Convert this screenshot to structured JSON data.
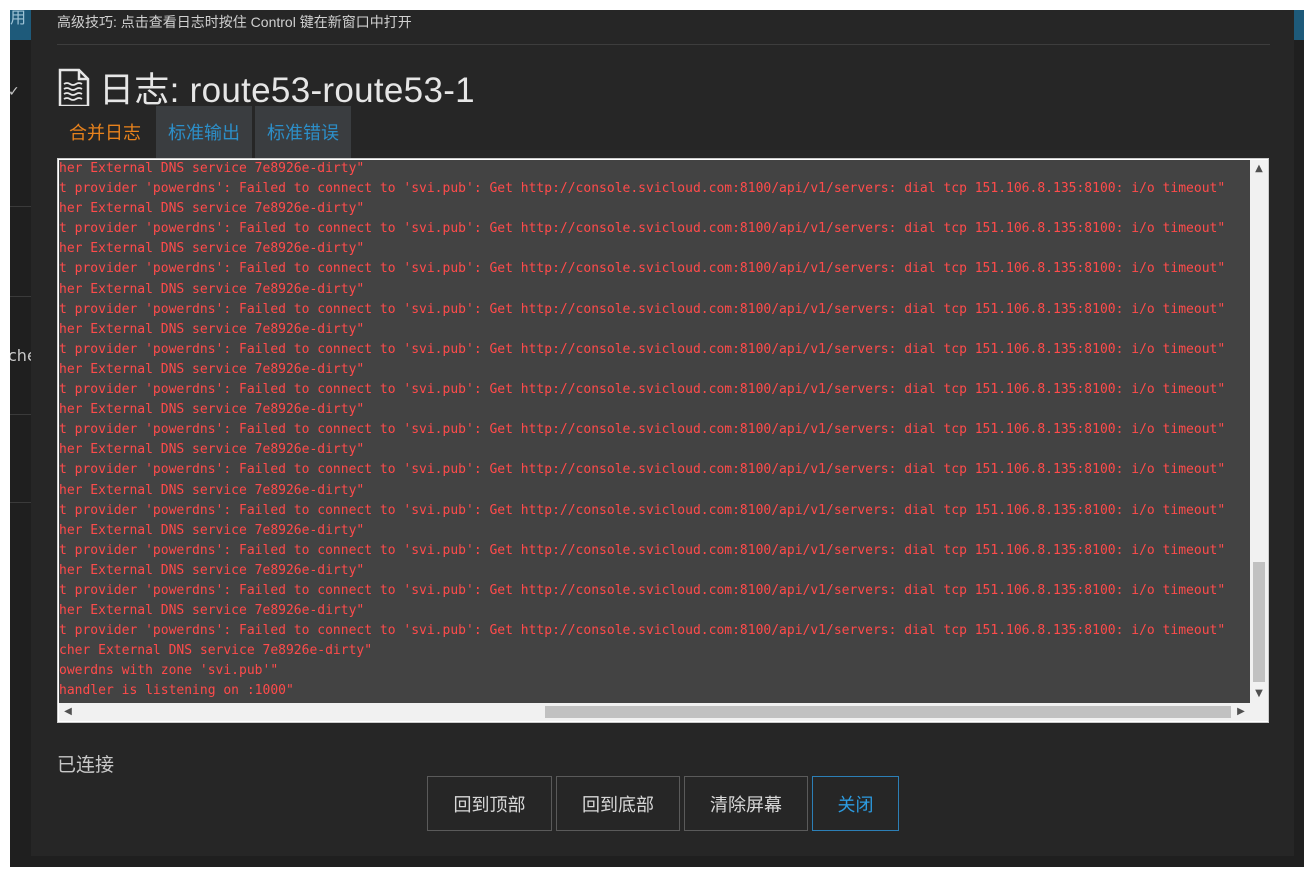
{
  "background": {
    "corner_text": "用",
    "side_text": "che"
  },
  "modal": {
    "tip": "高级技巧: 点击查看日志时按住 Control 键在新窗口中打开",
    "title": "日志: route53-route53-1",
    "tabs": [
      {
        "label": "合并日志",
        "active": true
      },
      {
        "label": "标准输出",
        "active": false
      },
      {
        "label": "标准错误",
        "active": false
      }
    ],
    "log_lines": [
      "her External DNS service 7e8926e-dirty\"",
      "t provider 'powerdns': Failed to connect to 'svi.pub': Get http://console.svicloud.com:8100/api/v1/servers: dial tcp 151.106.8.135:8100: i/o timeout\"",
      "her External DNS service 7e8926e-dirty\"",
      "t provider 'powerdns': Failed to connect to 'svi.pub': Get http://console.svicloud.com:8100/api/v1/servers: dial tcp 151.106.8.135:8100: i/o timeout\"",
      "her External DNS service 7e8926e-dirty\"",
      "t provider 'powerdns': Failed to connect to 'svi.pub': Get http://console.svicloud.com:8100/api/v1/servers: dial tcp 151.106.8.135:8100: i/o timeout\"",
      "her External DNS service 7e8926e-dirty\"",
      "t provider 'powerdns': Failed to connect to 'svi.pub': Get http://console.svicloud.com:8100/api/v1/servers: dial tcp 151.106.8.135:8100: i/o timeout\"",
      "her External DNS service 7e8926e-dirty\"",
      "t provider 'powerdns': Failed to connect to 'svi.pub': Get http://console.svicloud.com:8100/api/v1/servers: dial tcp 151.106.8.135:8100: i/o timeout\"",
      "her External DNS service 7e8926e-dirty\"",
      "t provider 'powerdns': Failed to connect to 'svi.pub': Get http://console.svicloud.com:8100/api/v1/servers: dial tcp 151.106.8.135:8100: i/o timeout\"",
      "her External DNS service 7e8926e-dirty\"",
      "t provider 'powerdns': Failed to connect to 'svi.pub': Get http://console.svicloud.com:8100/api/v1/servers: dial tcp 151.106.8.135:8100: i/o timeout\"",
      "her External DNS service 7e8926e-dirty\"",
      "t provider 'powerdns': Failed to connect to 'svi.pub': Get http://console.svicloud.com:8100/api/v1/servers: dial tcp 151.106.8.135:8100: i/o timeout\"",
      "her External DNS service 7e8926e-dirty\"",
      "t provider 'powerdns': Failed to connect to 'svi.pub': Get http://console.svicloud.com:8100/api/v1/servers: dial tcp 151.106.8.135:8100: i/o timeout\"",
      "her External DNS service 7e8926e-dirty\"",
      "t provider 'powerdns': Failed to connect to 'svi.pub': Get http://console.svicloud.com:8100/api/v1/servers: dial tcp 151.106.8.135:8100: i/o timeout\"",
      "her External DNS service 7e8926e-dirty\"",
      "t provider 'powerdns': Failed to connect to 'svi.pub': Get http://console.svicloud.com:8100/api/v1/servers: dial tcp 151.106.8.135:8100: i/o timeout\"",
      "her External DNS service 7e8926e-dirty\"",
      "t provider 'powerdns': Failed to connect to 'svi.pub': Get http://console.svicloud.com:8100/api/v1/servers: dial tcp 151.106.8.135:8100: i/o timeout\"",
      "cher External DNS service 7e8926e-dirty\"",
      "owerdns with zone 'svi.pub'\"",
      "handler is listening on :1000\""
    ],
    "status": "已连接",
    "buttons": {
      "top": "回到顶部",
      "bottom": "回到底部",
      "clear": "清除屏幕",
      "close": "关闭"
    },
    "scrollbar_arrows": {
      "up": "▲",
      "down": "▼",
      "left": "◀",
      "right": "▶"
    }
  }
}
